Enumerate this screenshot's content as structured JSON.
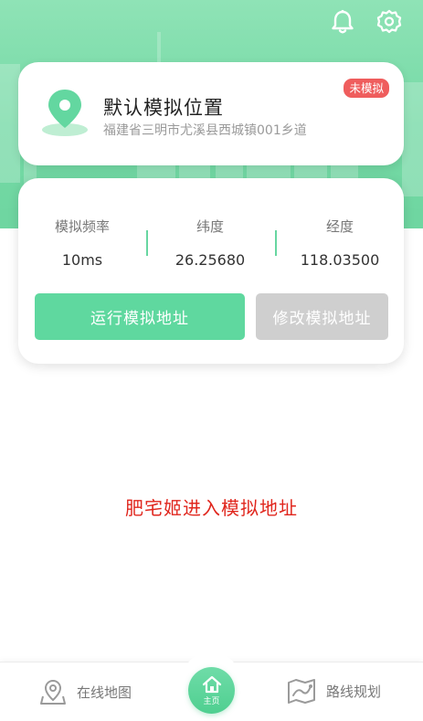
{
  "header": {
    "icons": [
      "bell-icon",
      "gear-icon"
    ]
  },
  "location": {
    "title": "默认模拟位置",
    "address": "福建省三明市尤溪县西城镇001乡道",
    "status_badge": "未模拟"
  },
  "stats": {
    "frequency_label": "模拟频率",
    "frequency_value": "10ms",
    "latitude_label": "纬度",
    "latitude_value": "26.25680",
    "longitude_label": "经度",
    "longitude_value": "118.03500"
  },
  "actions": {
    "run_label": "运行模拟地址",
    "edit_label": "修改模拟地址"
  },
  "message": "肥宅姬进入模拟地址",
  "bottom_nav": {
    "left_label": "在线地图",
    "home_label": "主页",
    "right_label": "路线规划"
  },
  "colors": {
    "accent": "#5fd89f",
    "badge": "#ef5d5d",
    "message": "#e0261d",
    "disabled": "#cfcfcf"
  }
}
